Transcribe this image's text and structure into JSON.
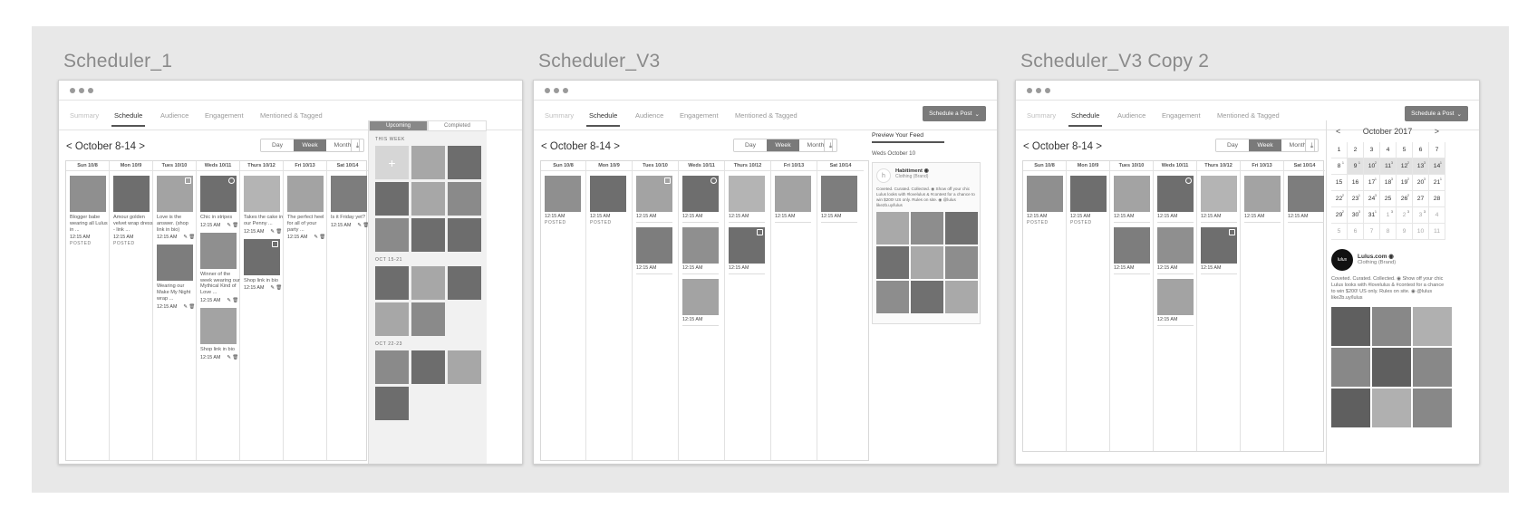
{
  "artboards": [
    {
      "title": "Scheduler_1"
    },
    {
      "title": "Scheduler_V3"
    },
    {
      "title": "Scheduler_V3 Copy 2"
    }
  ],
  "nav": {
    "tabs": [
      "Summary",
      "Schedule",
      "Audience",
      "Engagement",
      "Mentioned & Tagged"
    ],
    "schedule_button": "Schedule a Post",
    "chevron": "⌄"
  },
  "week": {
    "prev": "<",
    "label": "October 8-14",
    "next": ">",
    "views": [
      "Day",
      "Week",
      "Month"
    ],
    "download_icon": "download-icon",
    "days": [
      "Sun 10/8",
      "Mon 10/9",
      "Tues 10/10",
      "Weds 10/11",
      "Thurs 10/12",
      "Fri 10/13",
      "Sat 10/14"
    ]
  },
  "post": {
    "time": "12:15 AM",
    "posted": "POSTED",
    "actions": "✎ 🗑"
  },
  "v1_captions": {
    "sun": "Blogger babe wearing all Lulus in ...",
    "mon": "Amour golden velvet wrap dress - link ...",
    "tue1": "Love is the answer. (shop link in bio)",
    "tue2": "Wearing our Make My Night wrap ...",
    "wed1": "Chic in stripes",
    "wed2": "Winner of the week wearing our Mythical Kind of Love ...",
    "wed3": "Shop link in bio",
    "thu1": "Takes the cake in our Penny ...",
    "thu2": "Shop link in bio",
    "fri": "The perfect heel for all of your party ...",
    "sat": "Is it Friday yet?"
  },
  "side_panel": {
    "tabs": [
      "Upcoming",
      "Completed"
    ],
    "sections": [
      "THIS WEEK",
      "OCT 15-21",
      "OCT 22-23"
    ],
    "plus": "+"
  },
  "preview": {
    "title": "Preview Your Feed",
    "date": "Weds October 10",
    "brand_name": "Habitiment ◉",
    "brand_type": "Clothing (Brand)",
    "brand_logo": "h",
    "description": "Coveted. Curated. Collected. ◉ Show off your chic Lulus looks with #lovelulus & #contest for a chance to win $200! US only. Rules on site. ◉ @lulus like2b.uy/lulus"
  },
  "month_cal": {
    "prev": "<",
    "title": "October 2017",
    "next": ">",
    "rows": [
      [
        "1",
        "2",
        "3",
        "4",
        "5",
        "6",
        "7"
      ],
      [
        "8",
        "9",
        "10",
        "11",
        "12",
        "13",
        "14"
      ],
      [
        "15",
        "16",
        "17",
        "18",
        "19",
        "20",
        "21"
      ],
      [
        "22",
        "23",
        "24",
        "25",
        "26",
        "27",
        "28"
      ],
      [
        "29",
        "30",
        "31",
        "1",
        "2",
        "3",
        "4"
      ],
      [
        "5",
        "6",
        "7",
        "8",
        "9",
        "10",
        "11"
      ]
    ],
    "counts": {
      "1-0": "1",
      "1-1": "1",
      "1-2": "2",
      "1-3": "3",
      "1-4": "2",
      "1-5": "3",
      "1-6": "1",
      "2-2": "1",
      "2-3": "3",
      "2-4": "2",
      "2-5": "3",
      "2-6": "1",
      "3-0": "2",
      "3-1": "1",
      "3-2": "3",
      "3-4": "2",
      "4-0": "2",
      "4-1": "3",
      "4-2": "1",
      "4-3": "3",
      "4-4": "3",
      "4-5": "3"
    }
  },
  "lulus": {
    "logo_text": "lulus",
    "name": "Lulus.com ◉",
    "type": "Clothing (Brand)",
    "description": "Coveted. Curated. Collected. ◉ Show off your chic Lulus looks with #lovelulus & #contest for a chance to win $200! US only. Rules on site. ◉ @lulus like2b.uy/lulus"
  }
}
